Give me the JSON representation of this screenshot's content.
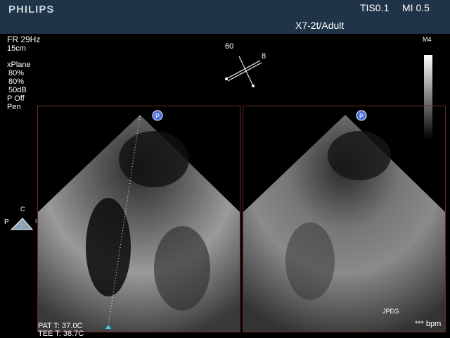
{
  "header": {
    "brand": "PHILIPS",
    "tis": "TIS0.1",
    "mi": "MI 0.5",
    "probe": "X7-2t/Adult"
  },
  "left_panel": {
    "frame_rate": "FR 29Hz",
    "depth": "15cm",
    "params": [
      "xPlane",
      "80%",
      "80%",
      "50dB",
      "P Off",
      "Pen"
    ]
  },
  "plane_indicator": {
    "angle_primary": "60",
    "angle_secondary": "8"
  },
  "grayscale_label": "M4",
  "orientation_marker": {
    "top": "C",
    "left": "P",
    "right": "R"
  },
  "temps": {
    "patient": "PAT T: 37.0C",
    "tee": "TEE T: 38.7C"
  },
  "footer": {
    "jpeg": "JPEG",
    "bpm": "*** bpm"
  },
  "colors": {
    "header_bg": "#1f3446",
    "frame_border": "#6b2a1f",
    "marker": "#4a6fd8"
  }
}
